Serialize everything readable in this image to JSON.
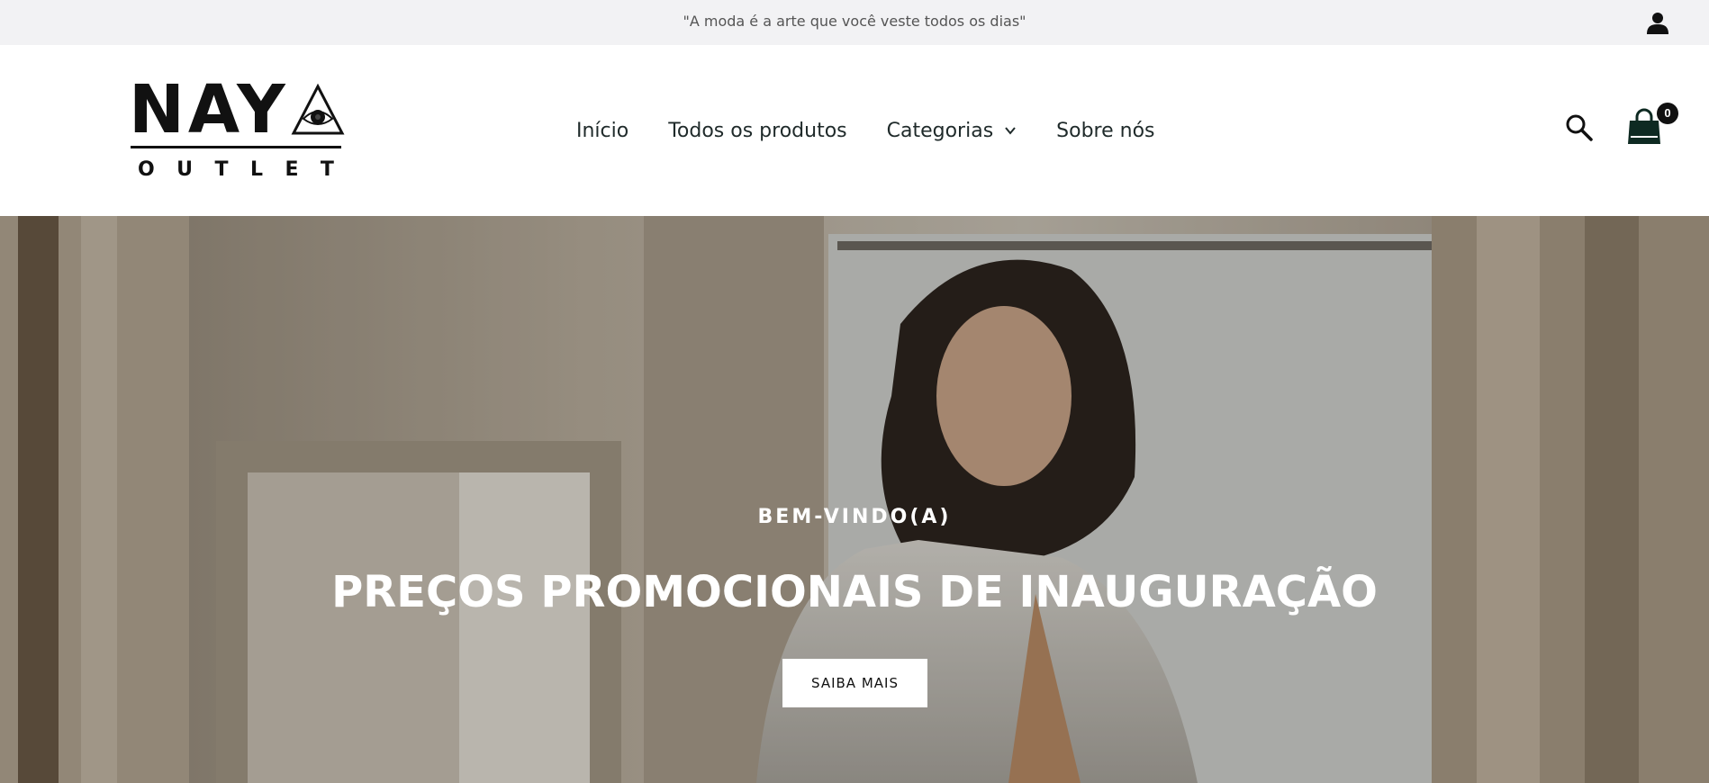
{
  "announcement": {
    "text": "\"A moda é a arte que você veste todos os dias\""
  },
  "icons": {
    "account": "account-icon",
    "search": "search-icon",
    "cart": "cart-icon",
    "chevron": "chevron-down-icon"
  },
  "logo": {
    "wordmark": "NAY",
    "subline": [
      "O",
      "U",
      "T",
      "L",
      "E",
      "T"
    ]
  },
  "nav": {
    "items": [
      {
        "label": "Início"
      },
      {
        "label": "Todos os produtos"
      },
      {
        "label": "Categorias"
      },
      {
        "label": "Sobre nós"
      }
    ]
  },
  "cart": {
    "count": "0"
  },
  "hero": {
    "eyebrow": "BEM-VINDO(A)",
    "title": "PREÇOS PROMOCIONAIS DE INAUGURAÇÃO",
    "cta_label": "SAIBA MAIS"
  },
  "colors": {
    "announcement_bg": "#f2f2f4",
    "text_dark": "#1f2a2a",
    "cart_badge": "#111111",
    "hero_text": "#ffffff"
  }
}
